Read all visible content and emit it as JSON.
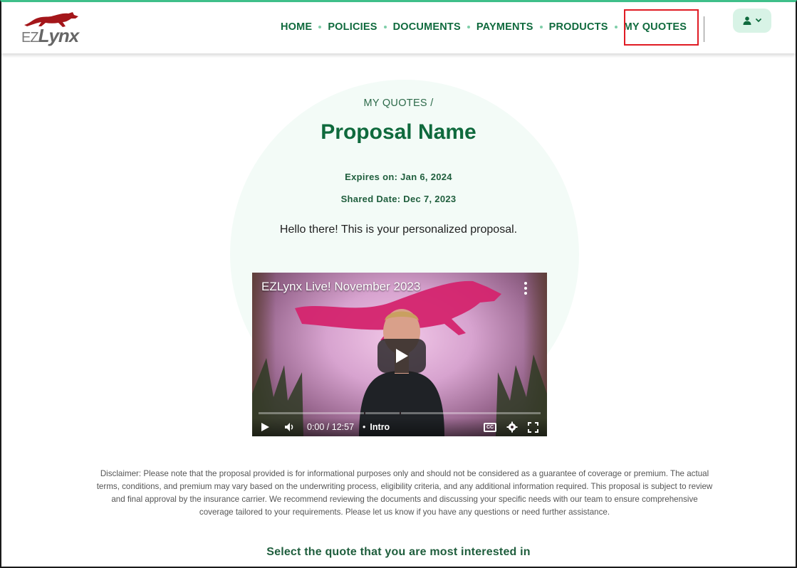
{
  "brand": {
    "logo_ez": "EZ",
    "logo_lynx": "Lynx"
  },
  "nav": {
    "items": [
      {
        "label": "HOME"
      },
      {
        "label": "POLICIES"
      },
      {
        "label": "DOCUMENTS"
      },
      {
        "label": "PAYMENTS"
      },
      {
        "label": "PRODUCTS"
      },
      {
        "label": "MY QUOTES"
      }
    ]
  },
  "page": {
    "breadcrumb": "MY QUOTES /",
    "title": "Proposal Name",
    "expires": "Expires on: Jan 6, 2024",
    "shared": "Shared Date: Dec 7, 2023",
    "greeting": "Hello there! This is your personalized proposal."
  },
  "video": {
    "title": "EZLynx Live! November 2023",
    "time": "0:00 / 12:57",
    "chapter": "Intro",
    "cc_label": "CC"
  },
  "disclaimer": "Disclaimer: Please note that the proposal provided is for informational purposes only and should not be considered as a guarantee of coverage or premium. The actual terms, conditions, and premium may vary based on the underwriting process, eligibility criteria, and any additional information required. This proposal is subject to review and final approval by the insurance carrier. We recommend reviewing the documents and discussing your specific needs with our team to ensure comprehensive coverage tailored to your requirements. Please let us know if you have any questions or need further assistance.",
  "select_heading": "Select the quote that you are most interested in",
  "colors": {
    "brand_green": "#0f6a3d",
    "accent_mint": "#d8f3e6",
    "highlight_red": "#e01b24",
    "logo_red": "#a4161a"
  },
  "icons": {
    "user": "user-icon",
    "chevron": "chevron-down-icon",
    "play": "play-icon",
    "volume": "volume-icon",
    "settings": "gear-icon",
    "fullscreen": "fullscreen-icon",
    "menu": "more-vertical-icon"
  }
}
